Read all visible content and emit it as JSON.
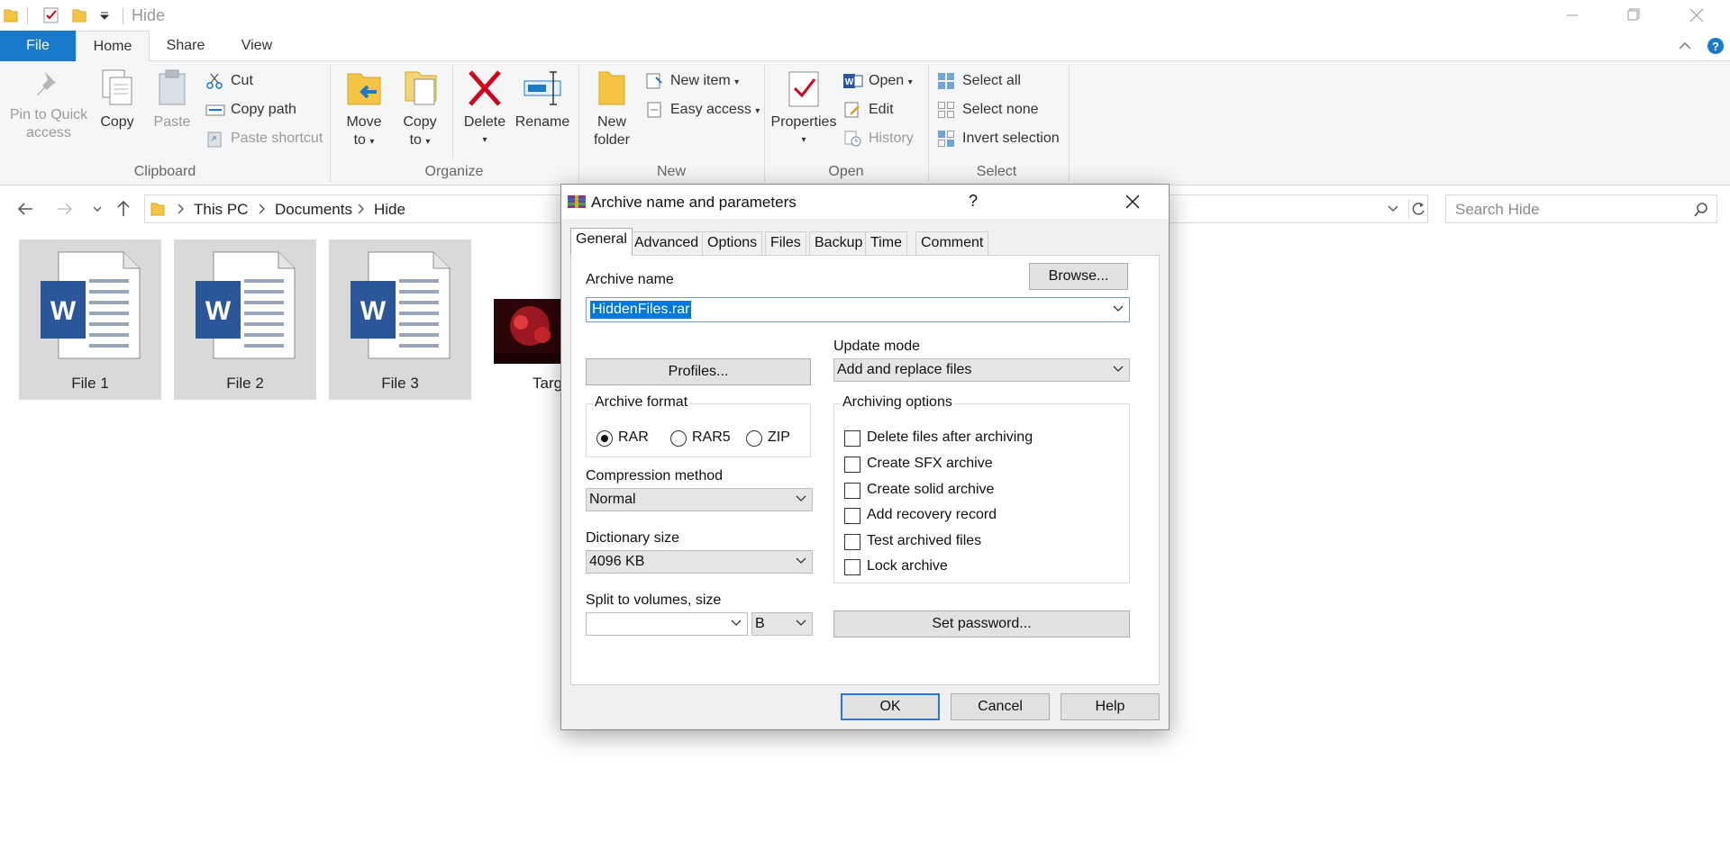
{
  "window": {
    "title": "Hide"
  },
  "ribbon_tabs": {
    "file": "File",
    "home": "Home",
    "share": "Share",
    "view": "View"
  },
  "ribbon": {
    "clipboard": {
      "group_label": "Clipboard",
      "pin_line1": "Pin to Quick",
      "pin_line2": "access",
      "copy": "Copy",
      "paste": "Paste",
      "cut": "Cut",
      "copy_path": "Copy path",
      "paste_shortcut": "Paste shortcut"
    },
    "organize": {
      "group_label": "Organize",
      "move_line1": "Move",
      "move_line2": "to",
      "copy_line1": "Copy",
      "copy_line2": "to",
      "delete": "Delete",
      "rename": "Rename"
    },
    "new": {
      "group_label": "New",
      "folder_line1": "New",
      "folder_line2": "folder",
      "new_item": "New item",
      "easy_access": "Easy access"
    },
    "open": {
      "group_label": "Open",
      "properties": "Properties",
      "open": "Open",
      "edit": "Edit",
      "history": "History"
    },
    "select": {
      "group_label": "Select",
      "select_all": "Select all",
      "select_none": "Select none",
      "invert": "Invert selection"
    }
  },
  "address": {
    "crumbs": [
      "This PC",
      "Documents",
      "Hide"
    ],
    "search_placeholder": "Search Hide"
  },
  "files": [
    {
      "name": "File 1",
      "type": "word-doc"
    },
    {
      "name": "File 2",
      "type": "word-doc"
    },
    {
      "name": "File 3",
      "type": "word-doc"
    },
    {
      "name": "Targ",
      "type": "image"
    }
  ],
  "dialog": {
    "title": "Archive name and parameters",
    "help_glyph": "?",
    "tabs": [
      "General",
      "Advanced",
      "Options",
      "Files",
      "Backup",
      "Time",
      "Comment"
    ],
    "archive_name_label": "Archive name",
    "archive_name_value": "HiddenFiles.rar",
    "browse_button": "Browse...",
    "profiles_button": "Profiles...",
    "update_mode_label": "Update mode",
    "update_mode_value": "Add and replace files",
    "archive_format_label": "Archive format",
    "formats": [
      "RAR",
      "RAR5",
      "ZIP"
    ],
    "selected_format": "RAR",
    "compression_label": "Compression method",
    "compression_value": "Normal",
    "dictionary_label": "Dictionary size",
    "dictionary_value": "4096 KB",
    "split_label": "Split to volumes, size",
    "split_value": "",
    "split_unit": "B",
    "archiving_options_label": "Archiving options",
    "options": [
      {
        "label": "Delete files after archiving",
        "checked": false
      },
      {
        "label": "Create SFX archive",
        "checked": false
      },
      {
        "label": "Create solid archive",
        "checked": false
      },
      {
        "label": "Add recovery record",
        "checked": false
      },
      {
        "label": "Test archived files",
        "checked": false
      },
      {
        "label": "Lock archive",
        "checked": false
      }
    ],
    "set_password_button": "Set password...",
    "ok": "OK",
    "cancel": "Cancel",
    "help": "Help"
  },
  "colors": {
    "accent": "#1979ca",
    "selection": "#0078d7",
    "word_blue": "#2b579a",
    "delete_red": "#d0021b",
    "folder": "#f4c542"
  }
}
